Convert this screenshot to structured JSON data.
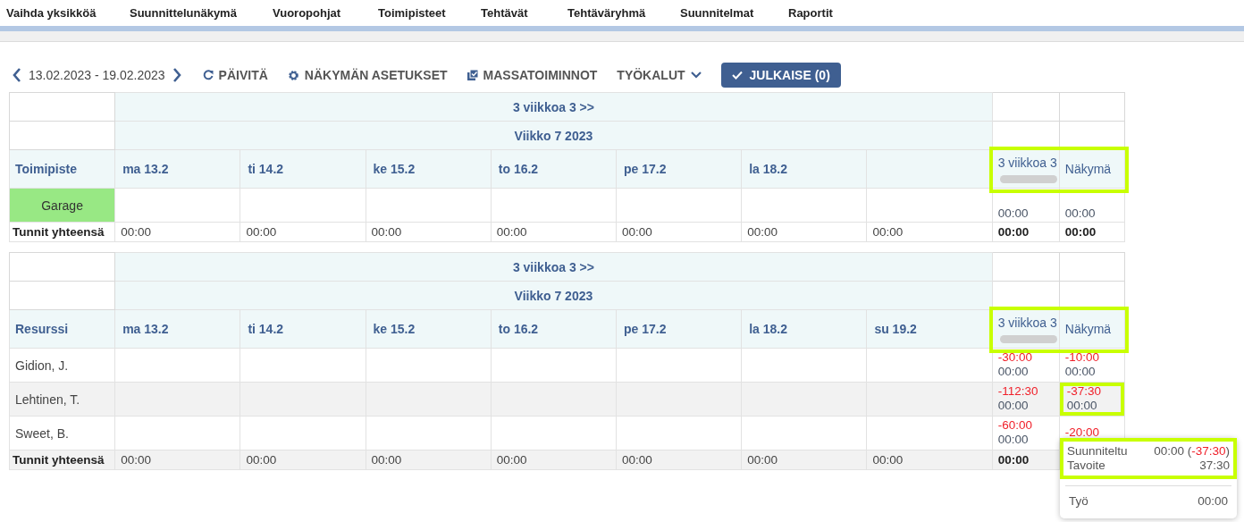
{
  "menu": [
    "Vaihda yksikköä",
    "Suunnittelunäkymä",
    "Vuoropohjat",
    "Toimipisteet",
    "Tehtävät",
    "Tehtäväryhmä",
    "Suunnitelmat",
    "Raportit"
  ],
  "toolbar": {
    "date_range": "13.02.2023 - 19.02.2023",
    "refresh": "PÄIVITÄ",
    "view_settings": "NÄKYMÄN ASETUKSET",
    "bulk_actions": "MASSATOIMINNOT",
    "tools": "TYÖKALUT",
    "publish": "JULKAISE (0)"
  },
  "tables": [
    {
      "period_header": "3 viikkoa 3 >>",
      "week_header": "Viikko 7 2023",
      "first_column": "Toimipiste",
      "days": [
        "ma 13.2",
        "ti 14.2",
        "ke 15.2",
        "to 16.2",
        "pe 17.2",
        "la 18.2"
      ],
      "summary_headers": [
        "3 viikkoa 3",
        "Näkymä"
      ],
      "summary_highlighted": true,
      "rows": [
        {
          "name": "Garage",
          "kind": "unit",
          "color": "#98e884",
          "shaded": false,
          "summary": [
            {
              "highlighted": false,
              "lines": [
                {
                  "text": "00:00",
                  "negative": false
                }
              ]
            },
            {
              "highlighted": false,
              "lines": [
                {
                  "text": "00:00",
                  "negative": false
                }
              ]
            }
          ]
        }
      ],
      "totals": {
        "label": "Tunnit yhteensä",
        "shaded": false,
        "days": [
          "00:00",
          "00:00",
          "00:00",
          "00:00",
          "00:00",
          "00:00",
          "00:00"
        ],
        "summary": [
          "00:00",
          "00:00"
        ]
      }
    },
    {
      "period_header": "3 viikkoa 3 >>",
      "week_header": "Viikko 7 2023",
      "first_column": "Resurssi",
      "days": [
        "ma 13.2",
        "ti 14.2",
        "ke 15.2",
        "to 16.2",
        "pe 17.2",
        "la 18.2",
        "su 19.2"
      ],
      "summary_headers": [
        "3 viikkoa 3",
        "Näkymä"
      ],
      "summary_highlighted": true,
      "rows": [
        {
          "name": "Gidion, J.",
          "kind": "resource",
          "shaded": false,
          "summary": [
            {
              "highlighted": false,
              "lines": [
                {
                  "text": "-30:00",
                  "negative": true
                },
                {
                  "text": "00:00",
                  "negative": false
                }
              ]
            },
            {
              "highlighted": false,
              "lines": [
                {
                  "text": "-10:00",
                  "negative": true
                },
                {
                  "text": "00:00",
                  "negative": false
                }
              ]
            }
          ]
        },
        {
          "name": "Lehtinen, T.",
          "kind": "resource",
          "shaded": true,
          "summary": [
            {
              "highlighted": false,
              "lines": [
                {
                  "text": "-112:30",
                  "negative": true
                },
                {
                  "text": "00:00",
                  "negative": false
                }
              ]
            },
            {
              "highlighted": true,
              "lines": [
                {
                  "text": "-37:30",
                  "negative": true
                },
                {
                  "text": "00:00",
                  "negative": false
                }
              ]
            }
          ]
        },
        {
          "name": "Sweet, B.",
          "kind": "resource",
          "shaded": false,
          "summary": [
            {
              "highlighted": false,
              "lines": [
                {
                  "text": "-60:00",
                  "negative": true
                },
                {
                  "text": "00:00",
                  "negative": false
                }
              ]
            },
            {
              "highlighted": false,
              "lines": [
                {
                  "text": "-20:00",
                  "negative": true
                }
              ]
            }
          ]
        }
      ],
      "totals": {
        "label": "Tunnit yhteensä",
        "shaded": true,
        "days": [
          "00:00",
          "00:00",
          "00:00",
          "00:00",
          "00:00",
          "00:00",
          "00:00"
        ],
        "summary": [
          "00:00"
        ]
      }
    }
  ],
  "tooltip": {
    "sections": [
      {
        "highlighted": true,
        "rows": [
          {
            "label": "Suunniteltu",
            "value": [
              {
                "text": "00:00 (",
                "negative": false
              },
              {
                "text": "-37:30",
                "negative": true
              },
              {
                "text": ")",
                "negative": false
              }
            ]
          },
          {
            "label": "Tavoite",
            "value": [
              {
                "text": "37:30",
                "negative": false
              }
            ]
          }
        ]
      },
      {
        "highlighted": false,
        "rows": [
          {
            "label": "Työ",
            "value": [
              {
                "text": "00:00",
                "negative": false
              }
            ]
          }
        ]
      }
    ]
  }
}
